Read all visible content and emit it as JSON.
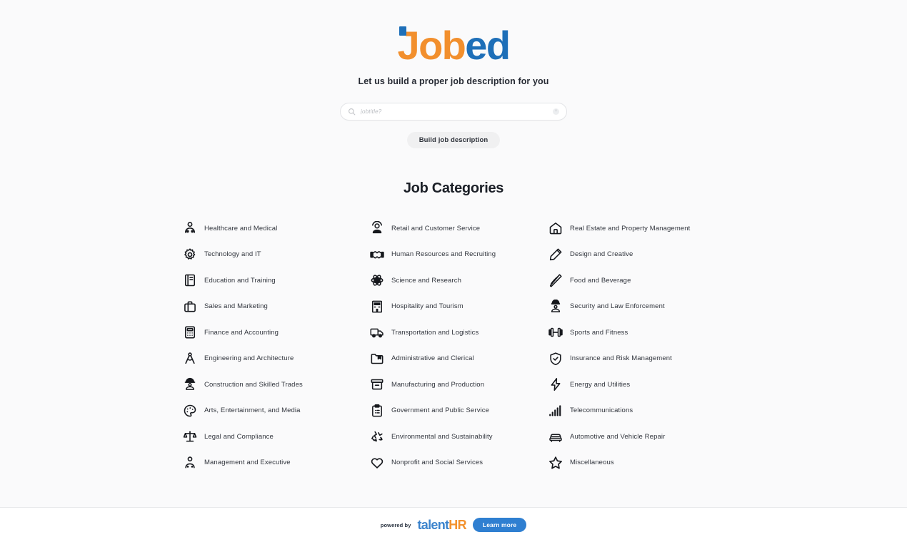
{
  "brand": {
    "logo_part1": "Job",
    "logo_part2": "ed",
    "logo_color_primary": "#f28f2d",
    "logo_color_secondary": "#1e6fb8",
    "tagline": "Let us build a proper job description for you"
  },
  "search": {
    "placeholder": "jobtitle?",
    "value": "",
    "icon": "search-icon",
    "clear_icon": "clear-circle-icon"
  },
  "actions": {
    "build_button": "Build job description"
  },
  "categories": {
    "title": "Job Categories",
    "columns": [
      [
        {
          "label": "Healthcare and Medical",
          "icon": "stethoscope-person-icon"
        },
        {
          "label": "Technology and IT",
          "icon": "gear-icon"
        },
        {
          "label": "Education and Training",
          "icon": "book-icon"
        },
        {
          "label": "Sales and Marketing",
          "icon": "briefcase-icon"
        },
        {
          "label": "Finance and Accounting",
          "icon": "calculator-icon"
        },
        {
          "label": "Engineering and Architecture",
          "icon": "compass-icon"
        },
        {
          "label": "Construction and Skilled Trades",
          "icon": "hardhat-worker-icon"
        },
        {
          "label": "Arts, Entertainment, and Media",
          "icon": "palette-icon"
        },
        {
          "label": "Legal and Compliance",
          "icon": "scales-icon"
        },
        {
          "label": "Management and Executive",
          "icon": "manager-person-icon"
        }
      ],
      [
        {
          "label": "Retail and Customer Service",
          "icon": "headset-person-icon"
        },
        {
          "label": "Human Resources and Recruiting",
          "icon": "handshake-icon"
        },
        {
          "label": "Science and Research",
          "icon": "atom-icon"
        },
        {
          "label": "Hospitality and Tourism",
          "icon": "hotel-building-icon"
        },
        {
          "label": "Transportation and Logistics",
          "icon": "truck-icon"
        },
        {
          "label": "Administrative and Clerical",
          "icon": "folder-bookmark-icon"
        },
        {
          "label": "Manufacturing and Production",
          "icon": "box-archive-icon"
        },
        {
          "label": "Government and Public Service",
          "icon": "clipboard-list-icon"
        },
        {
          "label": "Environmental and Sustainability",
          "icon": "recycle-icon"
        },
        {
          "label": "Nonprofit and Social Services",
          "icon": "heart-icon"
        }
      ],
      [
        {
          "label": "Real Estate and Property Management",
          "icon": "house-icon"
        },
        {
          "label": "Design and Creative",
          "icon": "pencil-icon"
        },
        {
          "label": "Food and Beverage",
          "icon": "pizza-slice-icon"
        },
        {
          "label": "Security and Law Enforcement",
          "icon": "police-officer-icon"
        },
        {
          "label": "Sports and Fitness",
          "icon": "dumbbell-icon"
        },
        {
          "label": "Insurance and Risk Management",
          "icon": "shield-check-icon"
        },
        {
          "label": "Energy and Utilities",
          "icon": "lightning-bolt-icon"
        },
        {
          "label": "Telecommunications",
          "icon": "signal-bars-icon"
        },
        {
          "label": "Automotive and Vehicle Repair",
          "icon": "car-icon"
        },
        {
          "label": "Miscellaneous",
          "icon": "star-icon"
        }
      ]
    ]
  },
  "footer": {
    "powered_by": "powered by",
    "brand_part1": "talent",
    "brand_part2": "HR",
    "brand_color_primary": "#3b83cc",
    "brand_color_secondary": "#f3922e",
    "learn_more": "Learn more",
    "learn_more_color": "#2f7fd1"
  }
}
